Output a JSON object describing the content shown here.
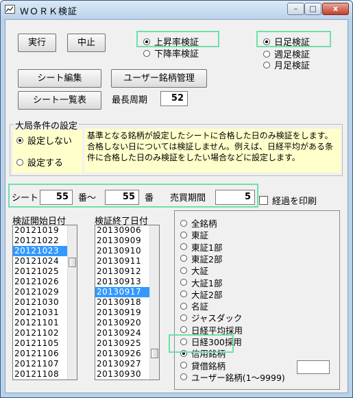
{
  "window": {
    "title": "ＷＯＲＫ検証",
    "minimize": "–",
    "maximize": "□",
    "close": "x"
  },
  "buttons": {
    "run": "実行",
    "stop": "中止",
    "sheet_edit": "シート編集",
    "user_stock": "ユーザー銘柄管理",
    "sheet_list": "シート一覧表"
  },
  "direction": {
    "up": "上昇率検証",
    "down": "下降率検証",
    "selected": "up"
  },
  "period": {
    "daily": "日足検証",
    "weekly": "週足検証",
    "monthly": "月足検証",
    "selected": "daily"
  },
  "max_cycle": {
    "label": "最長周期",
    "value": "52"
  },
  "market": {
    "title": "大局条件の設定",
    "off": "設定しない",
    "on": "設定する",
    "selected": "off",
    "note": "基準となる銘柄が設定したシートに合格した日のみ検証をします。合格しない日については検証しません。例えば、日経平均がある条件に合格した日のみ検証をしたい場合などに設定します。"
  },
  "sheet_range": {
    "label": "シート",
    "from": "55",
    "sep": "番～",
    "to": "55",
    "suffix": "番",
    "period_label": "売買期間",
    "period_value": "5"
  },
  "print_check": {
    "label": "経過を印刷",
    "checked": false
  },
  "start_list": {
    "title": "検証開始日付",
    "items": [
      "20121019",
      "20121022",
      "20121023",
      "20121024",
      "20121025",
      "20121026",
      "20121029",
      "20121030",
      "20121031",
      "20121101",
      "20121102",
      "20121105",
      "20121106",
      "20121107",
      "20121108"
    ],
    "selected_index": 2
  },
  "end_list": {
    "title": "検証終了日付",
    "items": [
      "20130906",
      "20130909",
      "20130910",
      "20130911",
      "20130912",
      "20130913",
      "20130917",
      "20130918",
      "20130919",
      "20130920",
      "20130924",
      "20130925",
      "20130926",
      "20130927",
      "20130930"
    ],
    "selected_index": 6
  },
  "market_filter": {
    "options": [
      "全銘柄",
      "東証",
      "東証1部",
      "東証2部",
      "大証",
      "大証1部",
      "大証2部",
      "名証",
      "ジャスダック",
      "日経平均採用",
      "日経300採用",
      "信用銘柄",
      "貸借銘柄",
      "ユーザー銘柄(1～9999)"
    ],
    "selected_index": 11
  },
  "colors": {
    "highlight": "#6fe0a8",
    "selection": "#3399ff",
    "note_bg": "#ffffcc"
  }
}
